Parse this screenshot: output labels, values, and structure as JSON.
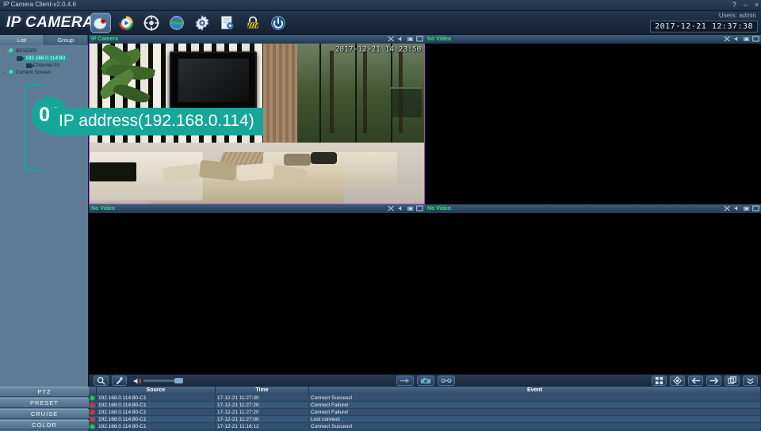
{
  "window": {
    "app_title": "IP Camera Client-v2.0.4.6",
    "help_label": "?",
    "minimize_label": "–",
    "close_label": "×"
  },
  "header": {
    "brand": "IP CAMERA",
    "users_label": "Users: admin",
    "datetime": "2017-12-21  12:37:38",
    "toolbar": [
      {
        "name": "live-view-icon",
        "label": "Live View",
        "selected": true
      },
      {
        "name": "playback-icon",
        "label": "Playback",
        "selected": false
      },
      {
        "name": "ptz-control-icon",
        "label": "PTZ Control",
        "selected": false
      },
      {
        "name": "network-globe-icon",
        "label": "Remote Device",
        "selected": false
      },
      {
        "name": "settings-gear-icon",
        "label": "Settings",
        "selected": false
      },
      {
        "name": "device-config-icon",
        "label": "Device Config",
        "selected": false
      },
      {
        "name": "lock-icon",
        "label": "Lock",
        "selected": false
      },
      {
        "name": "power-icon",
        "label": "Exit",
        "selected": false
      }
    ]
  },
  "sidebar": {
    "tabs": [
      {
        "label": "List",
        "active": true
      },
      {
        "label": "Group",
        "active": false
      }
    ],
    "tree": [
      {
        "label": "BESDER",
        "level": 1,
        "icon": "globe-icon",
        "selected": false,
        "expander": "-"
      },
      {
        "label": "192.168.0.114:80",
        "level": 2,
        "icon": "camera-icon",
        "selected": true,
        "expander": "-"
      },
      {
        "label": "Channel 01",
        "level": 3,
        "icon": "channel-icon",
        "selected": false,
        "expander": ""
      },
      {
        "label": "Current Screen",
        "level": 1,
        "icon": "globe-icon",
        "selected": false,
        "expander": "-"
      }
    ],
    "badge": "01",
    "buttons": [
      {
        "label": "PTZ"
      },
      {
        "label": "PRESET"
      },
      {
        "label": "CRUISE"
      },
      {
        "label": "COLOR"
      }
    ]
  },
  "annotation": {
    "text": "IP address(192.168.0.114)",
    "color": "#16a79a"
  },
  "grid": {
    "panels": [
      {
        "title": "IP Camera",
        "state": "live",
        "osd": "2017-12-21 14:23:50",
        "selected": true
      },
      {
        "title": "No Video",
        "state": "empty",
        "osd": "",
        "selected": false
      },
      {
        "title": "No Video",
        "state": "empty",
        "osd": "",
        "selected": false
      },
      {
        "title": "No Video",
        "state": "empty",
        "osd": "",
        "selected": false
      }
    ],
    "panel_controls": [
      {
        "name": "zoom-tool-icon"
      },
      {
        "name": "audio-icon"
      },
      {
        "name": "snapshot-icon"
      },
      {
        "name": "close-panel-icon"
      }
    ]
  },
  "bottom_toolbar": {
    "left": [
      {
        "name": "search-icon",
        "label": "Search"
      },
      {
        "name": "microphone-icon",
        "label": "Talk"
      }
    ],
    "volume": {
      "name": "speaker-icon",
      "level": 100
    },
    "middle": [
      {
        "name": "record-icon",
        "label": "Record"
      },
      {
        "name": "snapshot-camera-icon",
        "label": "Snapshot"
      },
      {
        "name": "connect-link-icon",
        "label": "Connect"
      }
    ],
    "right": [
      {
        "name": "grid-layout-icon",
        "label": "Layout"
      },
      {
        "name": "ptz-diamond-icon",
        "label": "PTZ"
      },
      {
        "name": "prev-arrow-icon",
        "label": "Previous"
      },
      {
        "name": "next-arrow-icon",
        "label": "Next"
      },
      {
        "name": "multi-window-icon",
        "label": "Windows"
      },
      {
        "name": "collapse-chevron-icon",
        "label": "Collapse"
      }
    ]
  },
  "log": {
    "columns": [
      "",
      "Source",
      "Time",
      "Event"
    ],
    "rows": [
      {
        "status": "ok",
        "source": "192.168.0.114:80-C1",
        "time": "17-12-21 11:27:30",
        "event": "Connect Success!"
      },
      {
        "status": "err",
        "source": "192.168.0.114:80-C1",
        "time": "17-12-21 11:27:20",
        "event": "Connect Failure!"
      },
      {
        "status": "err",
        "source": "192.168.0.114:80-C1",
        "time": "17-12-21 11:27:20",
        "event": "Connect Failure!"
      },
      {
        "status": "err",
        "source": "192.168.0.114:80-C1",
        "time": "17-12-21 11:27:00",
        "event": "Lost connect"
      },
      {
        "status": "ok",
        "source": "192.168.0.114:80-C1",
        "time": "17-12-21 11:16:12",
        "event": "Connect Success!"
      }
    ]
  }
}
